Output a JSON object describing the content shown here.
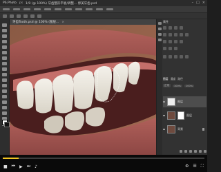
{
  "window": {
    "app": "PS.Photo",
    "version": "ps",
    "title": "1/9 (@ 100%) 牙齿整形平板/调整... 修美牙齿.psd",
    "controls": [
      "–",
      "□",
      "×"
    ]
  },
  "document_tab": {
    "label": "牙齿Tooth.psd @ 100% (图层..."
  },
  "properties_panel": {
    "header": "属性"
  },
  "layers_panel": {
    "tabs": [
      "图层",
      "通道",
      "路径"
    ],
    "blend_mode": "正常",
    "opacity": "100%",
    "fill": "100%",
    "layers": [
      {
        "name": "图层",
        "selected": true
      },
      {
        "name": "图层",
        "selected": false
      },
      {
        "name": "背景",
        "selected": false
      }
    ]
  },
  "video_player": {
    "progress": 0.08
  },
  "colors": {
    "accent": "#f3c623",
    "panel_bg": "#323232",
    "canvas_bg": "#585858"
  }
}
